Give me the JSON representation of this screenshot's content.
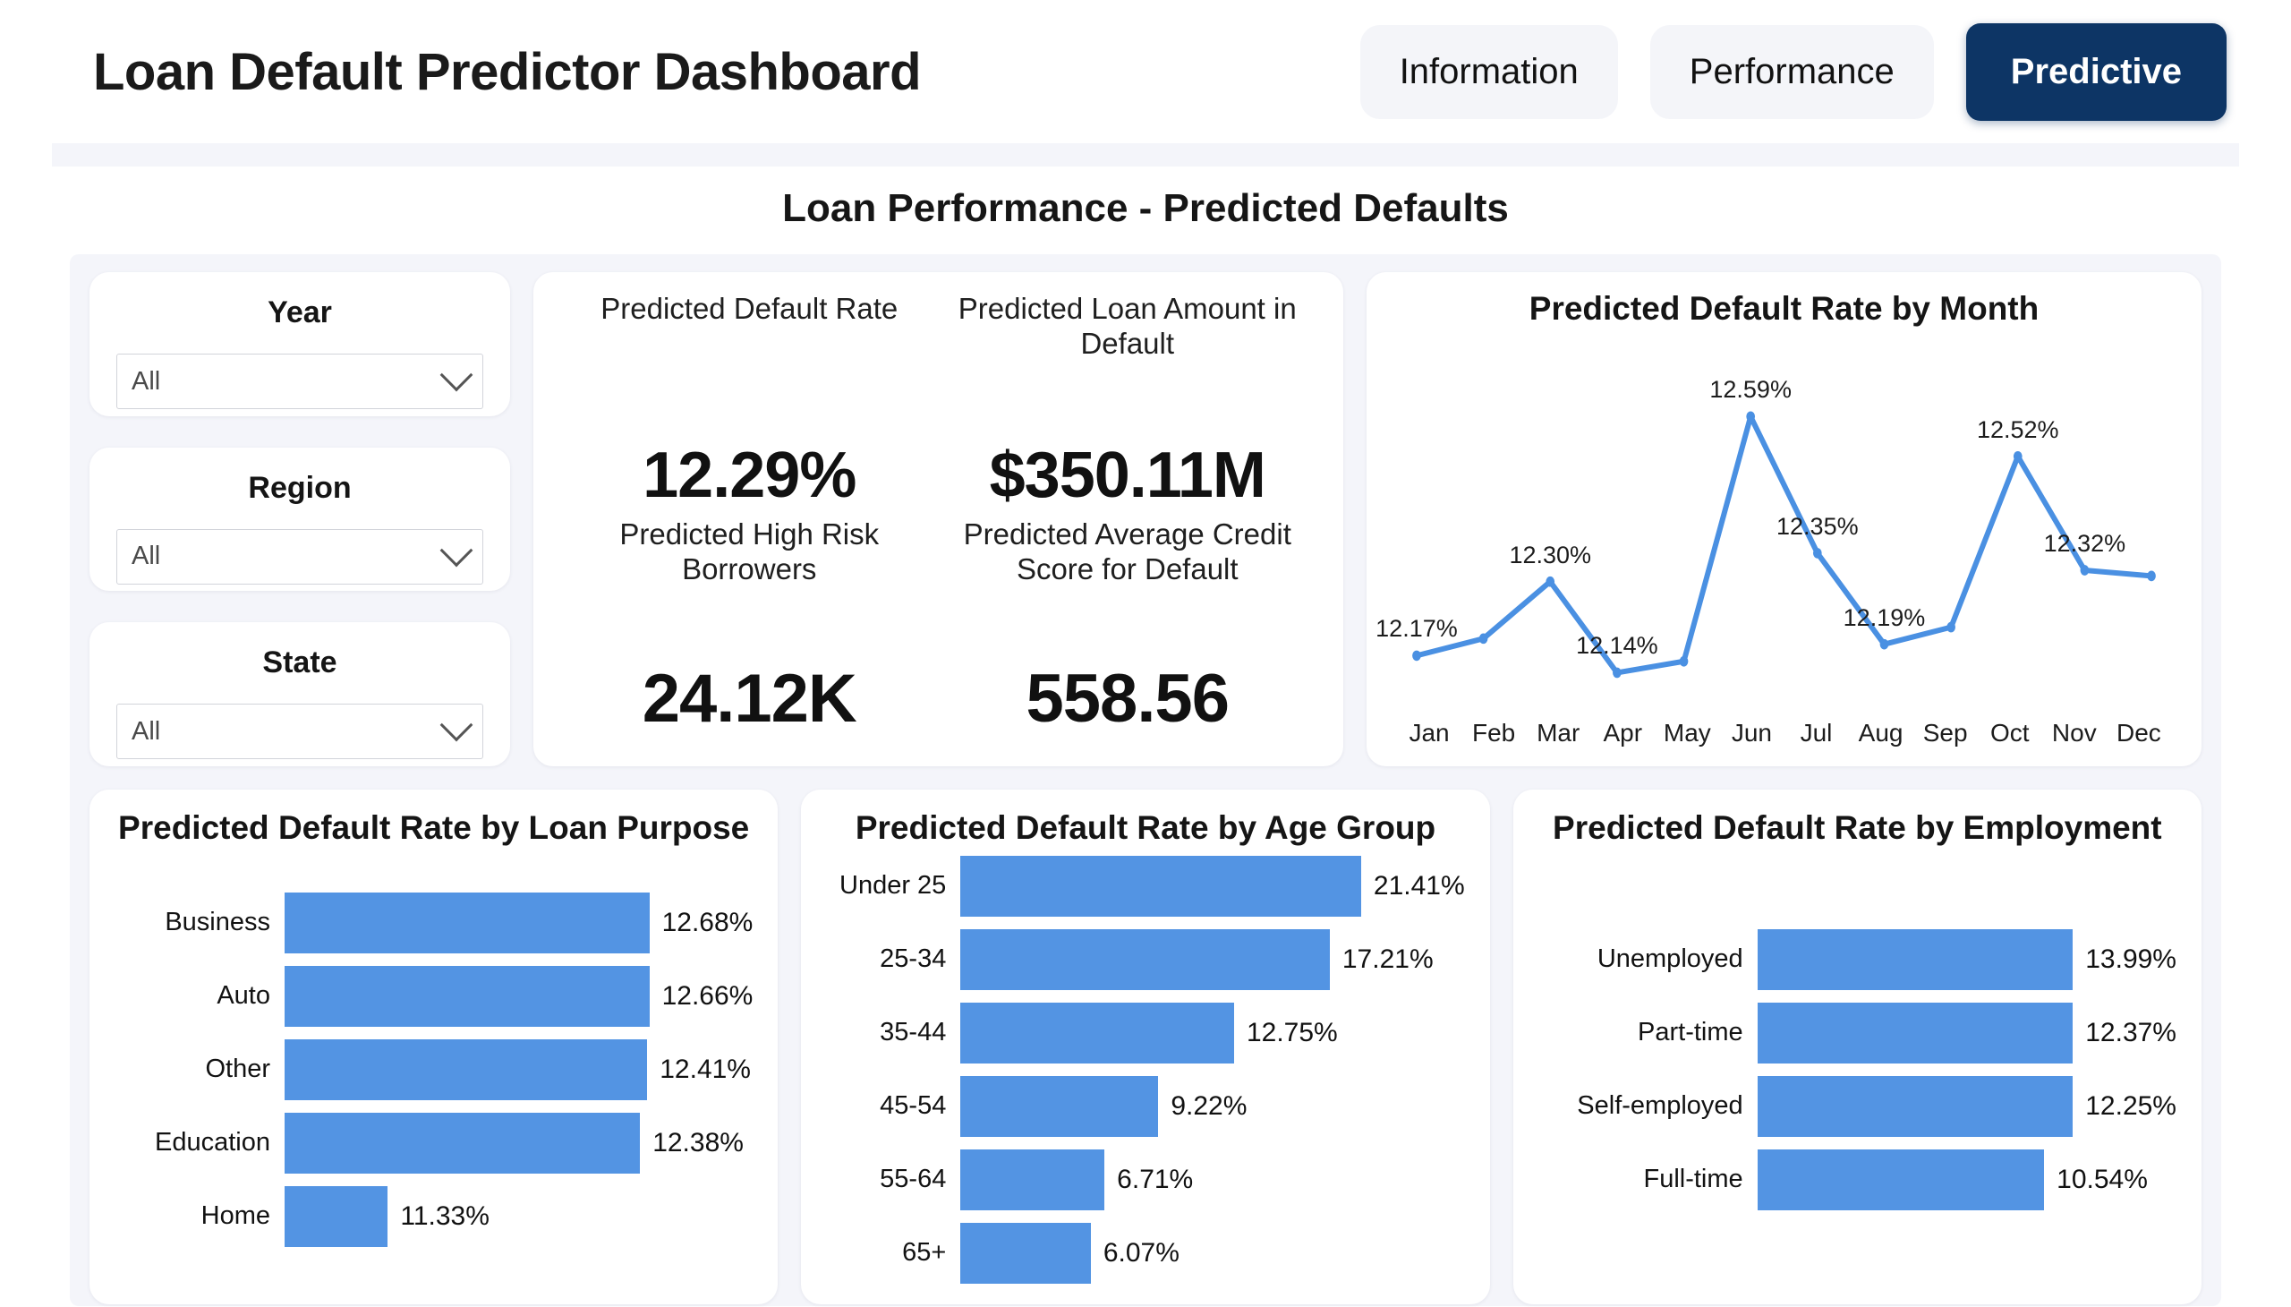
{
  "header": {
    "app_title": "Loan Default Predictor Dashboard",
    "tabs": [
      {
        "label": "Information",
        "active": false
      },
      {
        "label": "Performance",
        "active": false
      },
      {
        "label": "Predictive",
        "active": true
      }
    ]
  },
  "section_title": "Loan Performance - Predicted Defaults",
  "filters": [
    {
      "label": "Year",
      "value": "All",
      "icon": "chevron-down-icon"
    },
    {
      "label": "Region",
      "value": "All",
      "icon": "chevron-down-icon"
    },
    {
      "label": "State",
      "value": "All",
      "icon": "chevron-down-icon"
    }
  ],
  "kpis": [
    {
      "label": "Predicted Default Rate",
      "value": "12.29%"
    },
    {
      "label": "Predicted Loan Amount in Default",
      "value": "$350.11M"
    },
    {
      "label": "Predicted High Risk Borrowers",
      "value": "24.12K"
    },
    {
      "label": "Predicted Average Credit Score for Default",
      "value": "558.56"
    }
  ],
  "colors": {
    "accent_bar": "#5394e3",
    "accent_line": "#4a90e2",
    "tab_active_bg": "#0d3565",
    "tab_inactive_bg": "#f4f5f9",
    "panel_bg": "#f4f5fa",
    "card_bg": "#ffffff"
  },
  "chart_data": [
    {
      "type": "line",
      "title": "Predicted Default Rate by Month",
      "xlabel": "",
      "ylabel": "",
      "grid": false,
      "legend": "none",
      "categories": [
        "Jan",
        "Feb",
        "Mar",
        "Apr",
        "May",
        "Jun",
        "Jul",
        "Aug",
        "Sep",
        "Oct",
        "Nov",
        "Dec"
      ],
      "values": [
        12.17,
        12.2,
        12.3,
        12.14,
        12.16,
        12.59,
        12.35,
        12.19,
        12.22,
        12.52,
        12.32,
        12.31
      ],
      "point_labels": [
        "12.17%",
        "",
        "12.30%",
        "12.14%",
        "",
        "12.59%",
        "12.35%",
        "12.19%",
        "",
        "12.52%",
        "12.32%",
        ""
      ],
      "ylim": [
        12.1,
        12.64
      ]
    },
    {
      "type": "bar",
      "orientation": "horizontal",
      "title": "Predicted Default Rate by Loan Purpose",
      "categories": [
        "Business",
        "Auto",
        "Other",
        "Education",
        "Home"
      ],
      "values": [
        12.68,
        12.66,
        12.41,
        12.38,
        11.33
      ],
      "labels": [
        "12.68%",
        "12.66%",
        "12.41%",
        "12.38%",
        "11.33%"
      ],
      "xlim": [
        10.9,
        12.85
      ]
    },
    {
      "type": "bar",
      "orientation": "horizontal",
      "title": "Predicted Default Rate by Age Group",
      "categories": [
        "Under 25",
        "25-34",
        "35-44",
        "45-54",
        "55-64",
        "65+"
      ],
      "values": [
        21.41,
        17.21,
        12.75,
        9.22,
        6.71,
        6.07
      ],
      "labels": [
        "21.41%",
        "17.21%",
        "12.75%",
        "9.22%",
        "6.71%",
        "6.07%"
      ],
      "xlim": [
        0,
        23.5
      ]
    },
    {
      "type": "bar",
      "orientation": "horizontal",
      "title": "Predicted Default Rate by Employment",
      "categories": [
        "Unemployed",
        "Part-time",
        "Self-employed",
        "Full-time"
      ],
      "values": [
        13.99,
        12.37,
        12.25,
        10.54
      ],
      "labels": [
        "13.99%",
        "12.37%",
        "12.25%",
        "10.54%"
      ],
      "xlim": [
        0,
        15.4
      ]
    }
  ]
}
